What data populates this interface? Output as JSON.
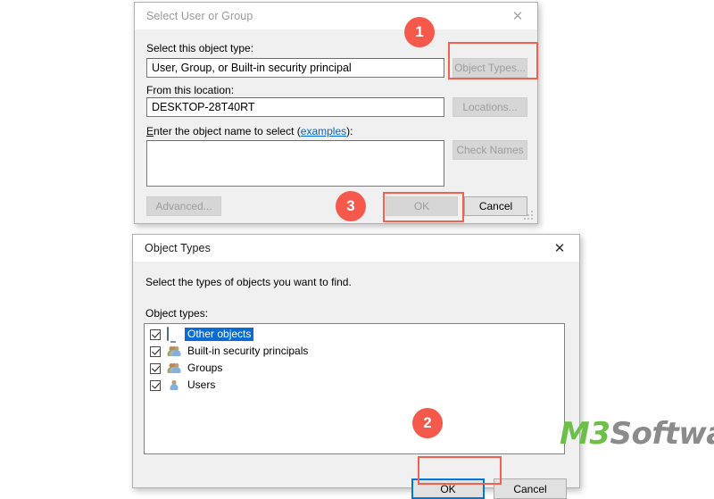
{
  "page": {
    "background": "#ffffff",
    "accent_annotation_color": "#f4594b",
    "selection_color": "#0a6cd2",
    "focus_color": "#0078d7"
  },
  "dialog_select_user": {
    "title": "Select User or Group",
    "active": false,
    "close_icon": "close-icon",
    "close_glyph": "✕",
    "object_type_label": "Select this object type:",
    "object_type_value": "User, Group, or Built-in security principal",
    "object_types_button": "Object Types...",
    "location_label": "From this location:",
    "location_value": "DESKTOP-28T40RT",
    "locations_button": "Locations...",
    "object_name_label_pre": "E",
    "object_name_label_main": "nter the object name to select (",
    "object_name_link": "examples",
    "object_name_label_post": "):",
    "object_name_value": "",
    "check_names_button": "Check Names",
    "advanced_button": "Advanced...",
    "ok_button": "OK",
    "cancel_button": "Cancel"
  },
  "dialog_object_types": {
    "title": "Object Types",
    "active": true,
    "close_icon": "close-icon",
    "close_glyph": "✕",
    "instruction": "Select the types of objects you want to find.",
    "list_label": "Object types:",
    "items": [
      {
        "label": "Other objects",
        "checked": true,
        "selected": true,
        "icon": "monitor-icon"
      },
      {
        "label": "Built-in security principals",
        "checked": true,
        "selected": false,
        "icon": "group-icon"
      },
      {
        "label": "Groups",
        "checked": true,
        "selected": false,
        "icon": "group-icon"
      },
      {
        "label": "Users",
        "checked": true,
        "selected": false,
        "icon": "user-icon"
      }
    ],
    "ok_button": "OK",
    "cancel_button": "Cancel"
  },
  "annotations": {
    "badges": [
      {
        "number": "1",
        "target": "object-types-button"
      },
      {
        "number": "2",
        "target": "object-types-ok-button"
      },
      {
        "number": "3",
        "target": "select-user-ok-button"
      }
    ]
  },
  "watermark": {
    "brand": "M3",
    "suffix": "Software"
  }
}
